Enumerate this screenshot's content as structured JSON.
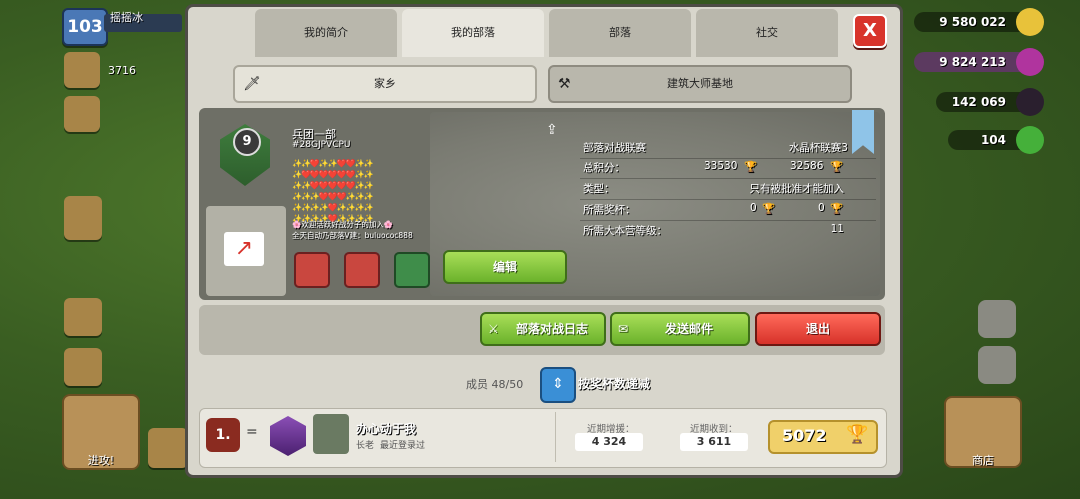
{
  "hud": {
    "level": "103",
    "player_name": "摇摇冰",
    "trophies": "3716",
    "trophy_hint": "2",
    "attack_label": "进攻!",
    "shop_label": "商店",
    "gold": "9 580 022",
    "elixir": "9 824 213",
    "dark_elixir": "142 069",
    "gems": "104"
  },
  "tabs": [
    "我的简介",
    "我的部落",
    "部落",
    "社交"
  ],
  "active_tab": 1,
  "close_label": "X",
  "subtabs": {
    "home": "家乡",
    "builder_base": "建筑大师基地"
  },
  "clan": {
    "level": "9",
    "name": "兵团一部",
    "tag": "#28GJPVCPU",
    "hearts_lines": [
      "✨✨❤️✨✨❤️❤️✨✨",
      "✨❤️❤️❤️❤️❤️❤️✨✨",
      "✨✨❤️❤️❤️❤️❤️✨✨",
      "✨✨✨❤️❤️❤️✨✨✨",
      "✨✨✨✨❤️✨✨✨✨",
      "✨✨✨✨❤️✨✨✨✨"
    ],
    "desc_line1": "🌸欢迎活跃好战分子的加入🌸",
    "desc_line2": "全天自动乃部落V建：buluococ888",
    "edit_label": "编辑",
    "war_league_label": "部落对战联赛",
    "war_league_value": "水晶杯联赛3",
    "total_points_label": "总积分：",
    "total_points_home": "33530",
    "total_points_builder": "32586",
    "type_label": "类型：",
    "type_value": "只有被批准才能加入",
    "req_trophies_label": "所需奖杯：",
    "req_trophies_home": "0",
    "req_trophies_builder": "0",
    "req_th_label": "所需大本营等级：",
    "req_th_value": "11"
  },
  "actions": {
    "war_log": "部落对战日志",
    "send_mail": "发送邮件",
    "leave": "退出"
  },
  "members": {
    "count_label": "成员 48/50",
    "sort_label": "按奖杯数递减"
  },
  "member_row": {
    "rank": "1.",
    "rank_change": "=",
    "name": "办心动于我",
    "role": "长老",
    "last_seen": "最近登录过",
    "donated_label": "近期增援：",
    "donated_value": "4 324",
    "received_label": "近期收到：",
    "received_value": "3 611",
    "trophies": "5072"
  },
  "colors": {
    "accent_green": "#6bb22b",
    "accent_red": "#d7322a",
    "dialog_bg": "#d8d6cc",
    "panel_dark": "#6e6f66"
  }
}
